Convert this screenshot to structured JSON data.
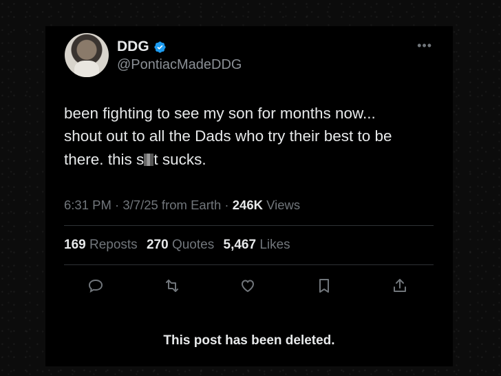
{
  "colors": {
    "background": "#000000",
    "text": "#e7e9ea",
    "muted": "#71767b",
    "verified": "#1d9bf0"
  },
  "author": {
    "name": "DDG",
    "handle": "@PontiacMadeDDG",
    "avatar": "avatar-photo",
    "verified_icon": "verified-badge-icon"
  },
  "tweet": {
    "line1": "been fighting to see my son for months now...",
    "line2": "shout out to all the Dads who try their best to be",
    "line3_a": "there. this s",
    "line3_b": "t sucks."
  },
  "meta": {
    "time": "6:31 PM",
    "sep1": " · ",
    "date": "3/7/25",
    "source": " from Earth",
    "sep2": " · ",
    "views_count": "246K",
    "views_label": " Views"
  },
  "stats": {
    "reposts_count": "169",
    "reposts_label": "Reposts",
    "quotes_count": "270",
    "quotes_label": "Quotes",
    "likes_count": "5,467",
    "likes_label": "Likes"
  },
  "actions": [
    "reply-icon",
    "repost-icon",
    "like-icon",
    "bookmark-icon",
    "share-icon"
  ],
  "more_icon": "more-options-icon",
  "notice": "This post has been deleted."
}
